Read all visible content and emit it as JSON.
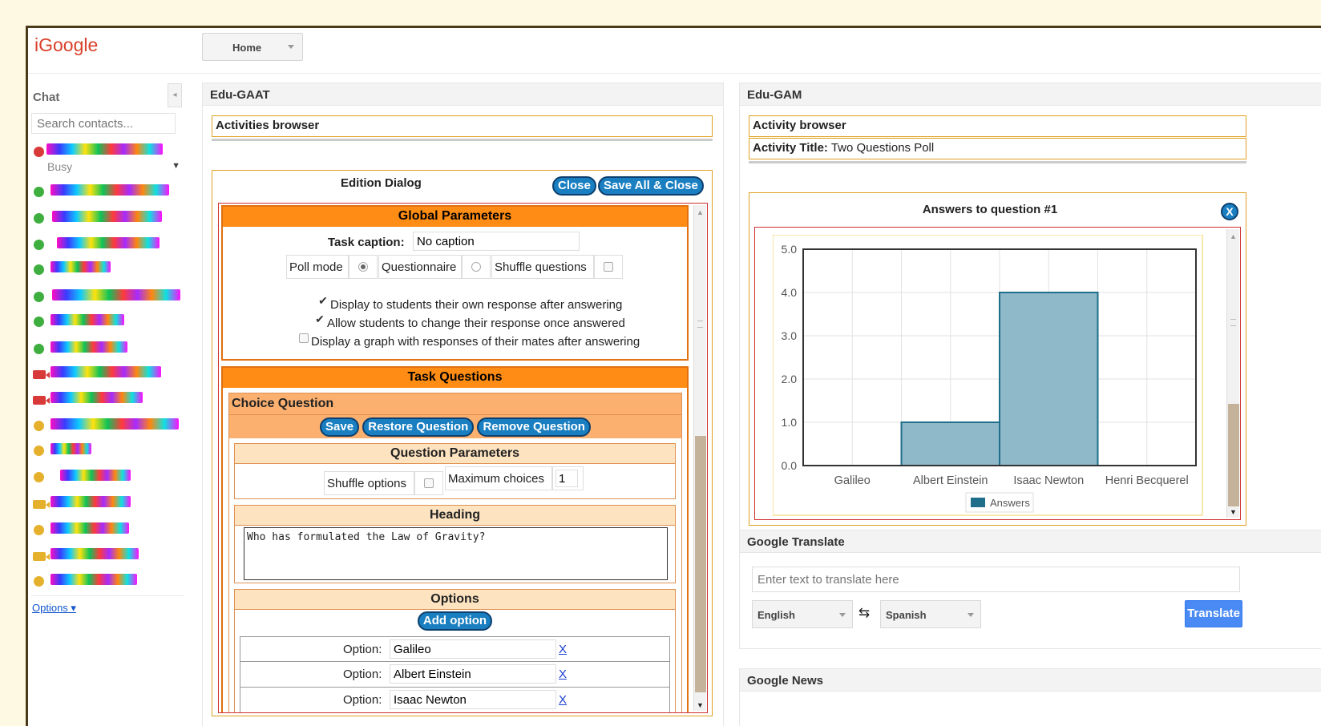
{
  "header": {
    "logo": "iGoogle",
    "home_tab": "Home"
  },
  "chat": {
    "title": "Chat",
    "search_placeholder": "Search contacts...",
    "self_status": "Busy",
    "options_link": "Options ▾",
    "contact_status": [
      "busy",
      "online",
      "online",
      "online",
      "online",
      "online",
      "online",
      "online",
      "video-busy",
      "video-busy",
      "idle",
      "idle",
      "idle",
      "video-idle",
      "idle",
      "video-idle",
      "idle"
    ]
  },
  "edu_gaat": {
    "title": "Edu-GAAT",
    "activities_browser": "Activities browser",
    "edition_dialog": {
      "title": "Edition Dialog",
      "close_label": "Close",
      "save_all_label": "Save All & Close"
    },
    "global_parameters": {
      "title": "Global Parameters",
      "task_caption_label": "Task caption:",
      "task_caption_value": "No caption",
      "poll_mode_label": "Poll mode",
      "questionnaire_label": "Questionnaire",
      "shuffle_questions_label": "Shuffle questions",
      "check1": "Display to students their own response after answering",
      "check2": "Allow students to change their response once answered",
      "check3": "Display a graph with responses of their mates after answering"
    },
    "task_questions": {
      "title": "Task Questions",
      "choice_question": "Choice Question",
      "save_label": "Save",
      "restore_label": "Restore Question",
      "remove_label": "Remove Question",
      "question_parameters": "Question Parameters",
      "shuffle_options_label": "Shuffle options",
      "max_choices_label": "Maximum choices",
      "max_choices_value": "1",
      "heading_title": "Heading",
      "heading_text": "Who has formulated the Law of Gravity?",
      "options_title": "Options",
      "add_option_label": "Add option",
      "option_label": "Option:",
      "remove_x": "X",
      "options": [
        "Galileo",
        "Albert Einstein",
        "Isaac Newton"
      ]
    }
  },
  "edu_gam": {
    "title": "Edu-GAM",
    "activity_browser": "Activity browser",
    "activity_title_label": "Activity Title:",
    "activity_title_value": "Two Questions Poll",
    "answers_title": "Answers to question #1",
    "close_x": "X"
  },
  "chart_data": {
    "type": "bar",
    "categories": [
      "Galileo",
      "Albert Einstein",
      "Isaac Newton",
      "Henri Becquerel"
    ],
    "series": [
      {
        "name": "Answers",
        "values": [
          0,
          1,
          4,
          0
        ]
      }
    ],
    "ylim": [
      0,
      5
    ],
    "yticks": [
      "0.0",
      "1.0",
      "2.0",
      "3.0",
      "4.0",
      "5.0"
    ],
    "grid": true,
    "legend": "bottom",
    "bar_color": "#8fb8c9",
    "bar_stroke": "#1f6f8b"
  },
  "translate": {
    "title": "Google Translate",
    "placeholder": "Enter text to translate here",
    "from_lang": "English",
    "to_lang": "Spanish",
    "button": "Translate"
  },
  "news": {
    "title": "Google News"
  }
}
